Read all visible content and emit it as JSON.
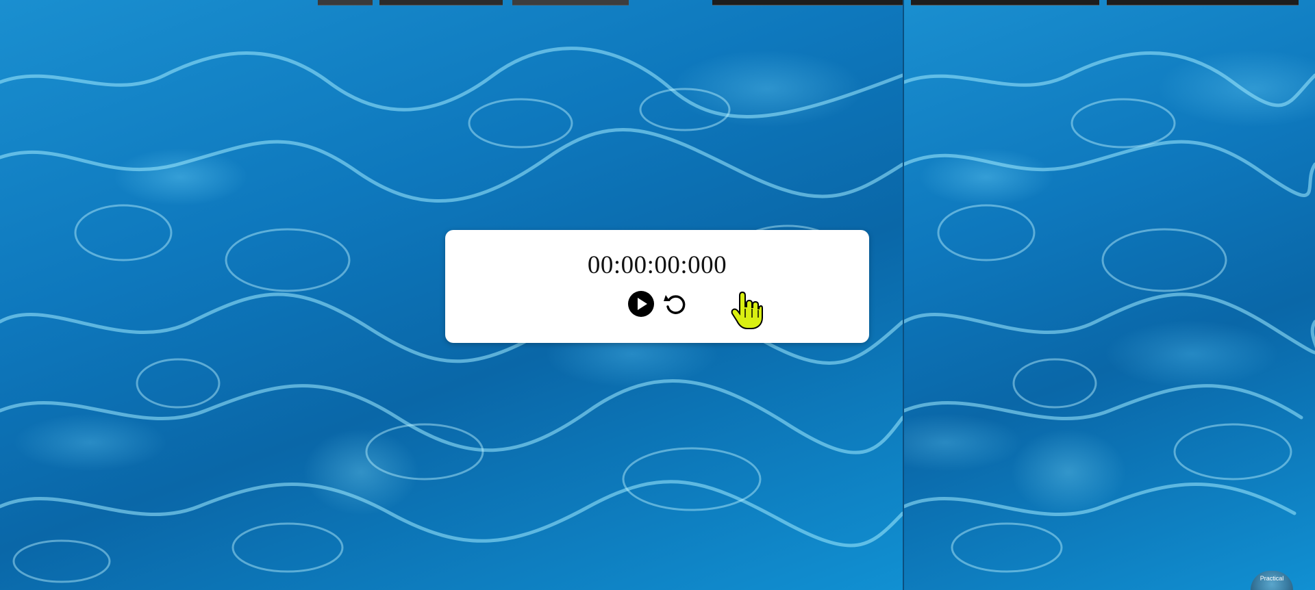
{
  "stopwatch": {
    "time": "00:00:00:000",
    "play_icon": "play-circle-icon",
    "reset_icon": "reset-rotate-icon"
  },
  "logo": {
    "text": "Practical"
  },
  "colors": {
    "card_background": "#ffffff",
    "water_primary": "#0e78bd",
    "cursor_fill": "#d9ef12"
  }
}
